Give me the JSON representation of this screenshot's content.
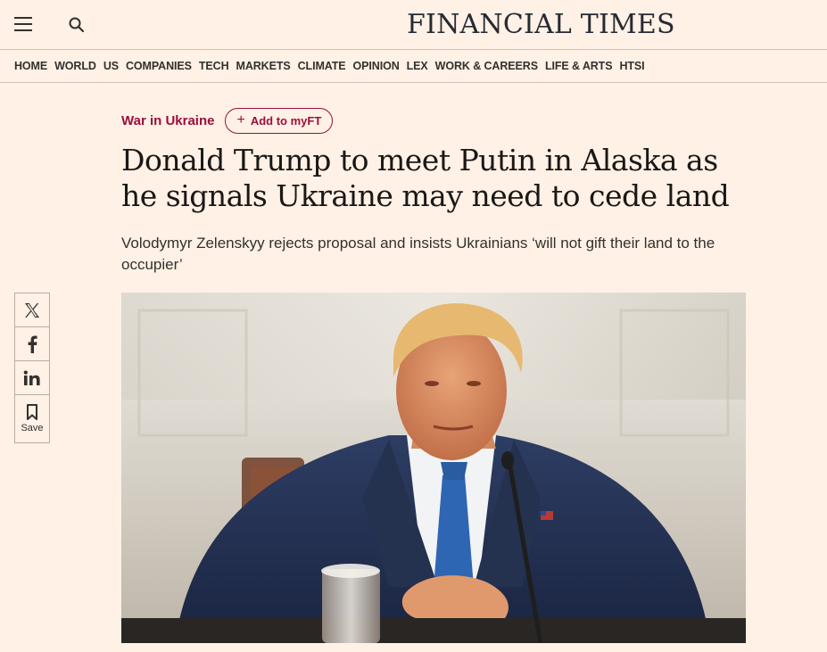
{
  "header": {
    "brand": "FINANCIAL TIMES",
    "menu_icon": "hamburger-menu-icon",
    "search_icon": "search-icon"
  },
  "nav": {
    "items": [
      "HOME",
      "WORLD",
      "US",
      "COMPANIES",
      "TECH",
      "MARKETS",
      "CLIMATE",
      "OPINION",
      "LEX",
      "WORK & CAREERS",
      "LIFE & ARTS",
      "HTSI"
    ]
  },
  "article": {
    "topic": "War in Ukraine",
    "myft_label": "Add to myFT",
    "headline": "Donald Trump to meet Putin in Alaska as he signals Ukraine may need to cede land",
    "standfirst": "Volodymyr Zelenskyy rejects proposal and insists Ukrainians ‘will not gift their land to the occupier’"
  },
  "share": {
    "items": [
      {
        "icon": "x-twitter-icon"
      },
      {
        "icon": "facebook-icon"
      },
      {
        "icon": "linkedin-icon"
      },
      {
        "icon": "bookmark-icon",
        "label": "Save"
      }
    ]
  },
  "colors": {
    "background": "#fff1e5",
    "accent": "#990f3d",
    "text": "#33302e"
  }
}
